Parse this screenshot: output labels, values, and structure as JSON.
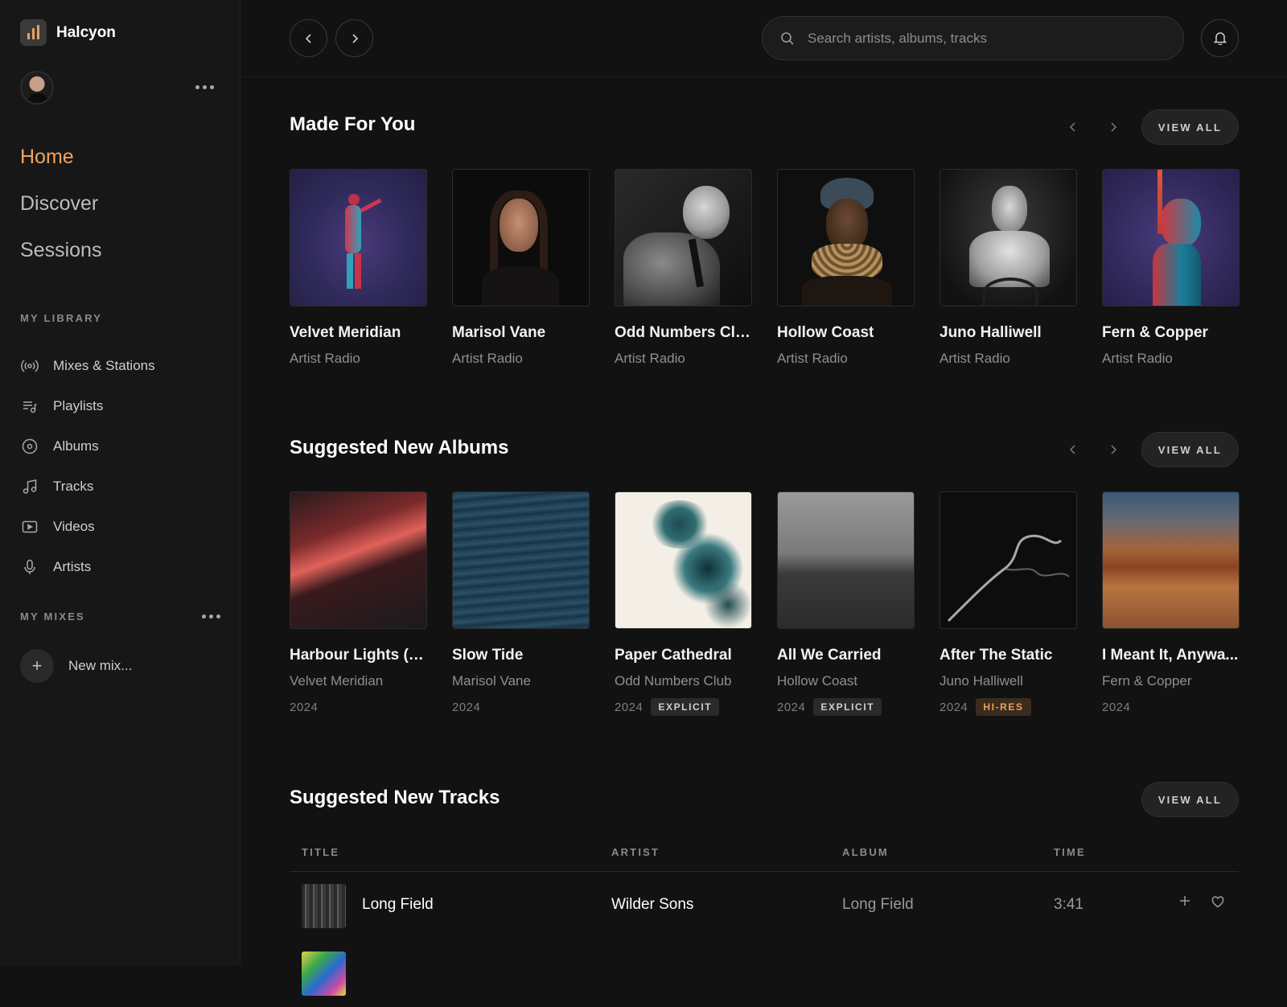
{
  "app": {
    "name": "Halcyon"
  },
  "sidebar": {
    "nav": [
      {
        "label": "Home",
        "active": true
      },
      {
        "label": "Discover",
        "active": false
      },
      {
        "label": "Sessions",
        "active": false
      }
    ],
    "library_label": "MY LIBRARY",
    "library": [
      {
        "label": "Mixes & Stations",
        "icon": "radio-icon"
      },
      {
        "label": "Playlists",
        "icon": "playlist-icon"
      },
      {
        "label": "Albums",
        "icon": "album-icon"
      },
      {
        "label": "Tracks",
        "icon": "music-note-icon"
      },
      {
        "label": "Videos",
        "icon": "video-icon"
      },
      {
        "label": "Artists",
        "icon": "microphone-icon"
      }
    ],
    "mixes_label": "MY MIXES",
    "new_mix_label": "New mix..."
  },
  "topbar": {
    "search_placeholder": "Search artists, albums, tracks"
  },
  "made_for_you": {
    "title": "Made For You",
    "view_all": "VIEW ALL",
    "items": [
      {
        "name": "Velvet Meridian",
        "sub": "Artist Radio"
      },
      {
        "name": "Marisol Vane",
        "sub": "Artist Radio"
      },
      {
        "name": "Odd Numbers Club",
        "sub": "Artist Radio"
      },
      {
        "name": "Hollow Coast",
        "sub": "Artist Radio"
      },
      {
        "name": "Juno Halliwell",
        "sub": "Artist Radio"
      },
      {
        "name": "Fern & Copper",
        "sub": "Artist Radio"
      }
    ]
  },
  "suggested_albums": {
    "title": "Suggested New Albums",
    "view_all": "VIEW ALL",
    "items": [
      {
        "title": "Harbour Lights (L...",
        "artist": "Velvet Meridian",
        "year": "2024",
        "badge": ""
      },
      {
        "title": "Slow Tide",
        "artist": "Marisol Vane",
        "year": "2024",
        "badge": ""
      },
      {
        "title": "Paper Cathedral",
        "artist": "Odd Numbers Club",
        "year": "2024",
        "badge": "EXPLICIT"
      },
      {
        "title": "All We Carried",
        "artist": "Hollow Coast",
        "year": "2024",
        "badge": "EXPLICIT"
      },
      {
        "title": "After The Static",
        "artist": "Juno Halliwell",
        "year": "2024",
        "badge": "HI-RES"
      },
      {
        "title": "I Meant It, Anywa...",
        "artist": "Fern & Copper",
        "year": "2024",
        "badge": ""
      }
    ]
  },
  "suggested_tracks": {
    "title": "Suggested New Tracks",
    "view_all": "VIEW ALL",
    "columns": [
      "TITLE",
      "ARTIST",
      "ALBUM",
      "TIME"
    ],
    "rows": [
      {
        "title": "Long Field",
        "artist": "Wilder Sons",
        "album": "Long Field",
        "time": "3:41"
      }
    ]
  },
  "colors": {
    "accent": "#f0a35e",
    "background": "#121212",
    "sidebar": "#171717"
  }
}
